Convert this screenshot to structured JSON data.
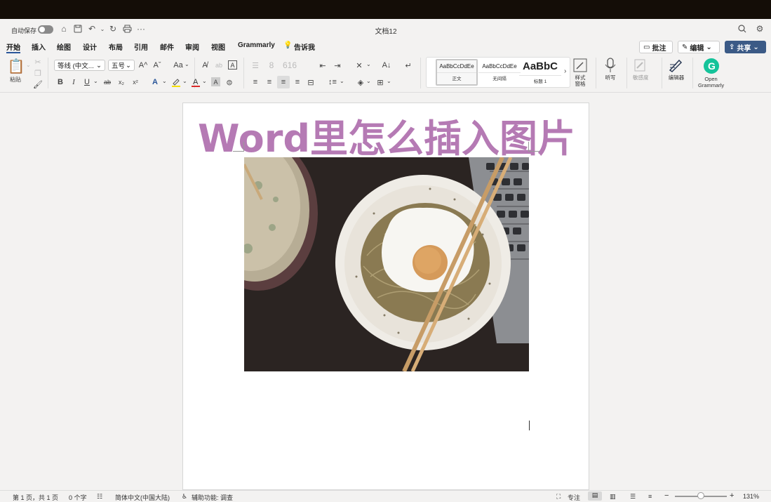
{
  "titlebar": {
    "autosave_label": "自动保存",
    "doc_title": "文档12",
    "icons": [
      "home-icon",
      "save-icon",
      "undo-icon",
      "redo-icon",
      "print-icon",
      "more-icon",
      "search-icon",
      "settings-icon"
    ]
  },
  "tabs": [
    "开始",
    "插入",
    "绘图",
    "设计",
    "布局",
    "引用",
    "邮件",
    "审阅",
    "视图",
    "Grammarly"
  ],
  "tell_me": "告诉我",
  "top_buttons": {
    "comments": "批注",
    "editing": "编辑",
    "share": "共享"
  },
  "ribbon": {
    "paste_label": "粘贴",
    "font_name": "等线 (中文...",
    "font_size": "五号",
    "styles": [
      {
        "preview": "AaBbCcDdEe",
        "name": "正文"
      },
      {
        "preview": "AaBbCcDdEe",
        "name": "无间隔"
      },
      {
        "preview": "AaBbC",
        "name": "标题 1"
      }
    ],
    "styles_pane_label": "样式\n窗格",
    "dictate_label": "听写",
    "sensitivity_label": "敏感度",
    "editor_label": "编辑器",
    "grammarly_label": "Open\nGrammarly",
    "font_size_up": "A^",
    "font_size_down": "Aˇ",
    "change_case": "Aa",
    "bold": "B",
    "italic": "I",
    "underline": "U",
    "strike": "ab",
    "subscript": "x₂",
    "superscript": "x²"
  },
  "document": {
    "heading": "Word里怎么插入图片"
  },
  "statusbar": {
    "page": "第 1 页，共 1 页",
    "words": "0 个字",
    "language": "简体中文(中国大陆)",
    "accessibility": "辅助功能: 调查",
    "focus": "专注",
    "zoom": "131%"
  }
}
